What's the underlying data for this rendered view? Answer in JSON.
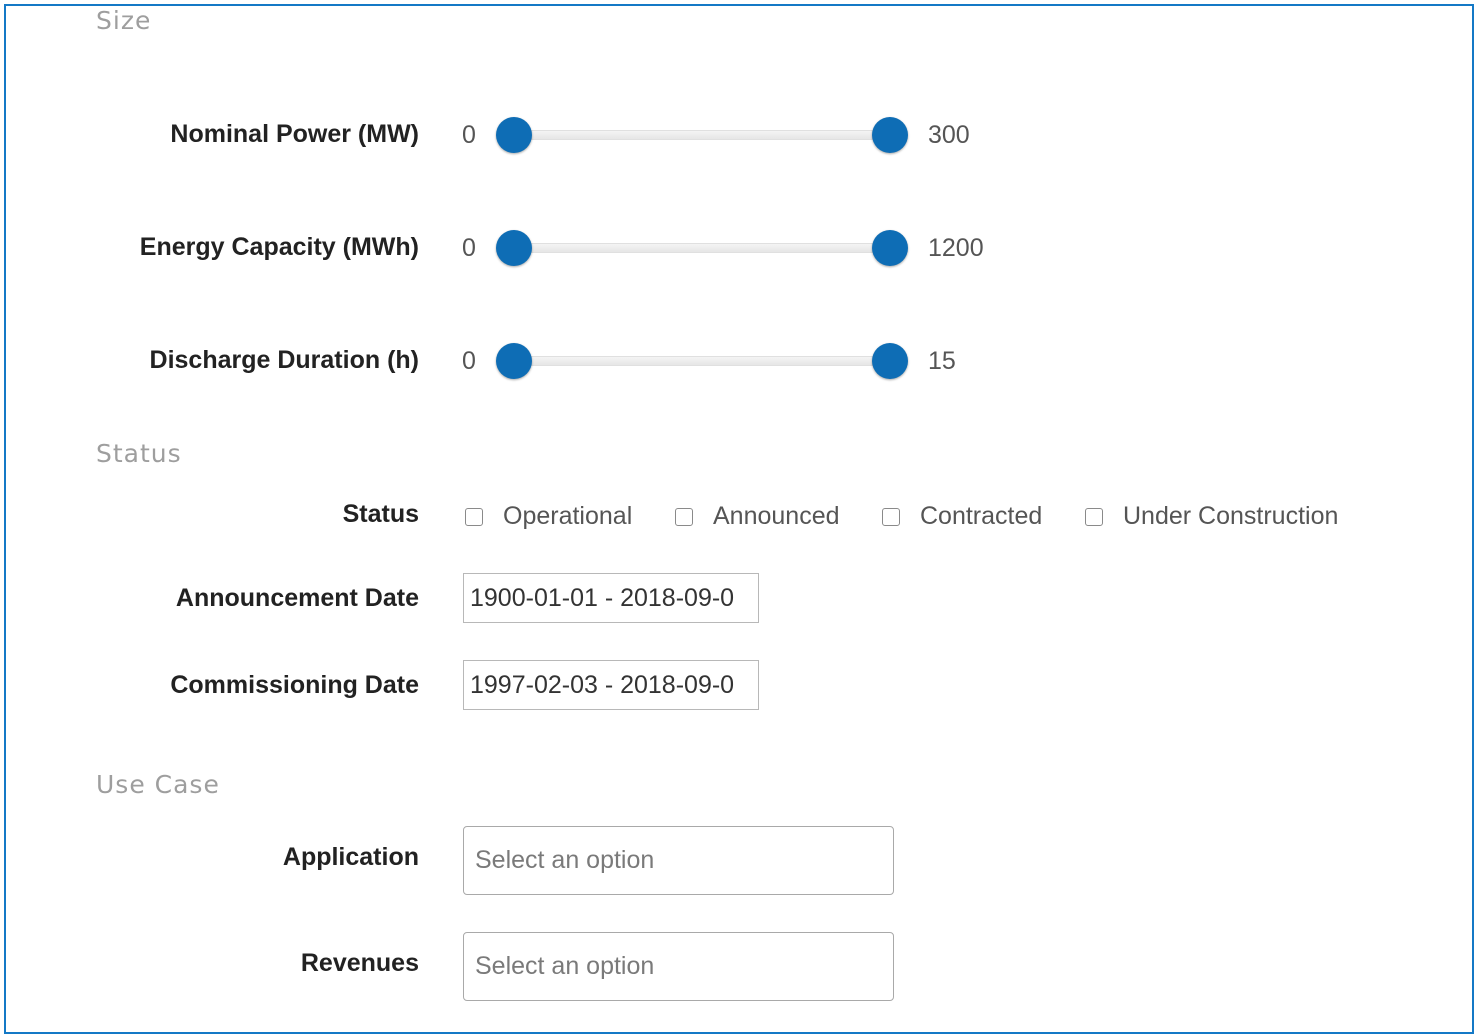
{
  "sections": {
    "size": "Size",
    "status": "Status",
    "use_case": "Use Case"
  },
  "size": {
    "nominal_power": {
      "label": "Nominal Power (MW)",
      "min": "0",
      "max": "300",
      "low_fraction": 0,
      "high_fraction": 1
    },
    "energy_capacity": {
      "label": "Energy Capacity (MWh)",
      "min": "0",
      "max": "1200",
      "low_fraction": 0,
      "high_fraction": 1
    },
    "discharge_duration": {
      "label": "Discharge Duration (h)",
      "min": "0",
      "max": "15",
      "low_fraction": 0,
      "high_fraction": 1
    }
  },
  "status": {
    "label": "Status",
    "options": [
      "Operational",
      "Announced",
      "Contracted",
      "Under Construction"
    ],
    "announcement_date": {
      "label": "Announcement Date",
      "value": "1900-01-01 - 2018-09-0"
    },
    "commissioning_date": {
      "label": "Commissioning Date",
      "value": "1997-02-03 - 2018-09-0"
    }
  },
  "use_case": {
    "application": {
      "label": "Application",
      "placeholder": "Select an option"
    },
    "revenues": {
      "label": "Revenues",
      "placeholder": "Select an option"
    }
  },
  "colors": {
    "accent": "#0e6db5",
    "frame": "#1479c6",
    "heading": "#9e9e9e"
  }
}
